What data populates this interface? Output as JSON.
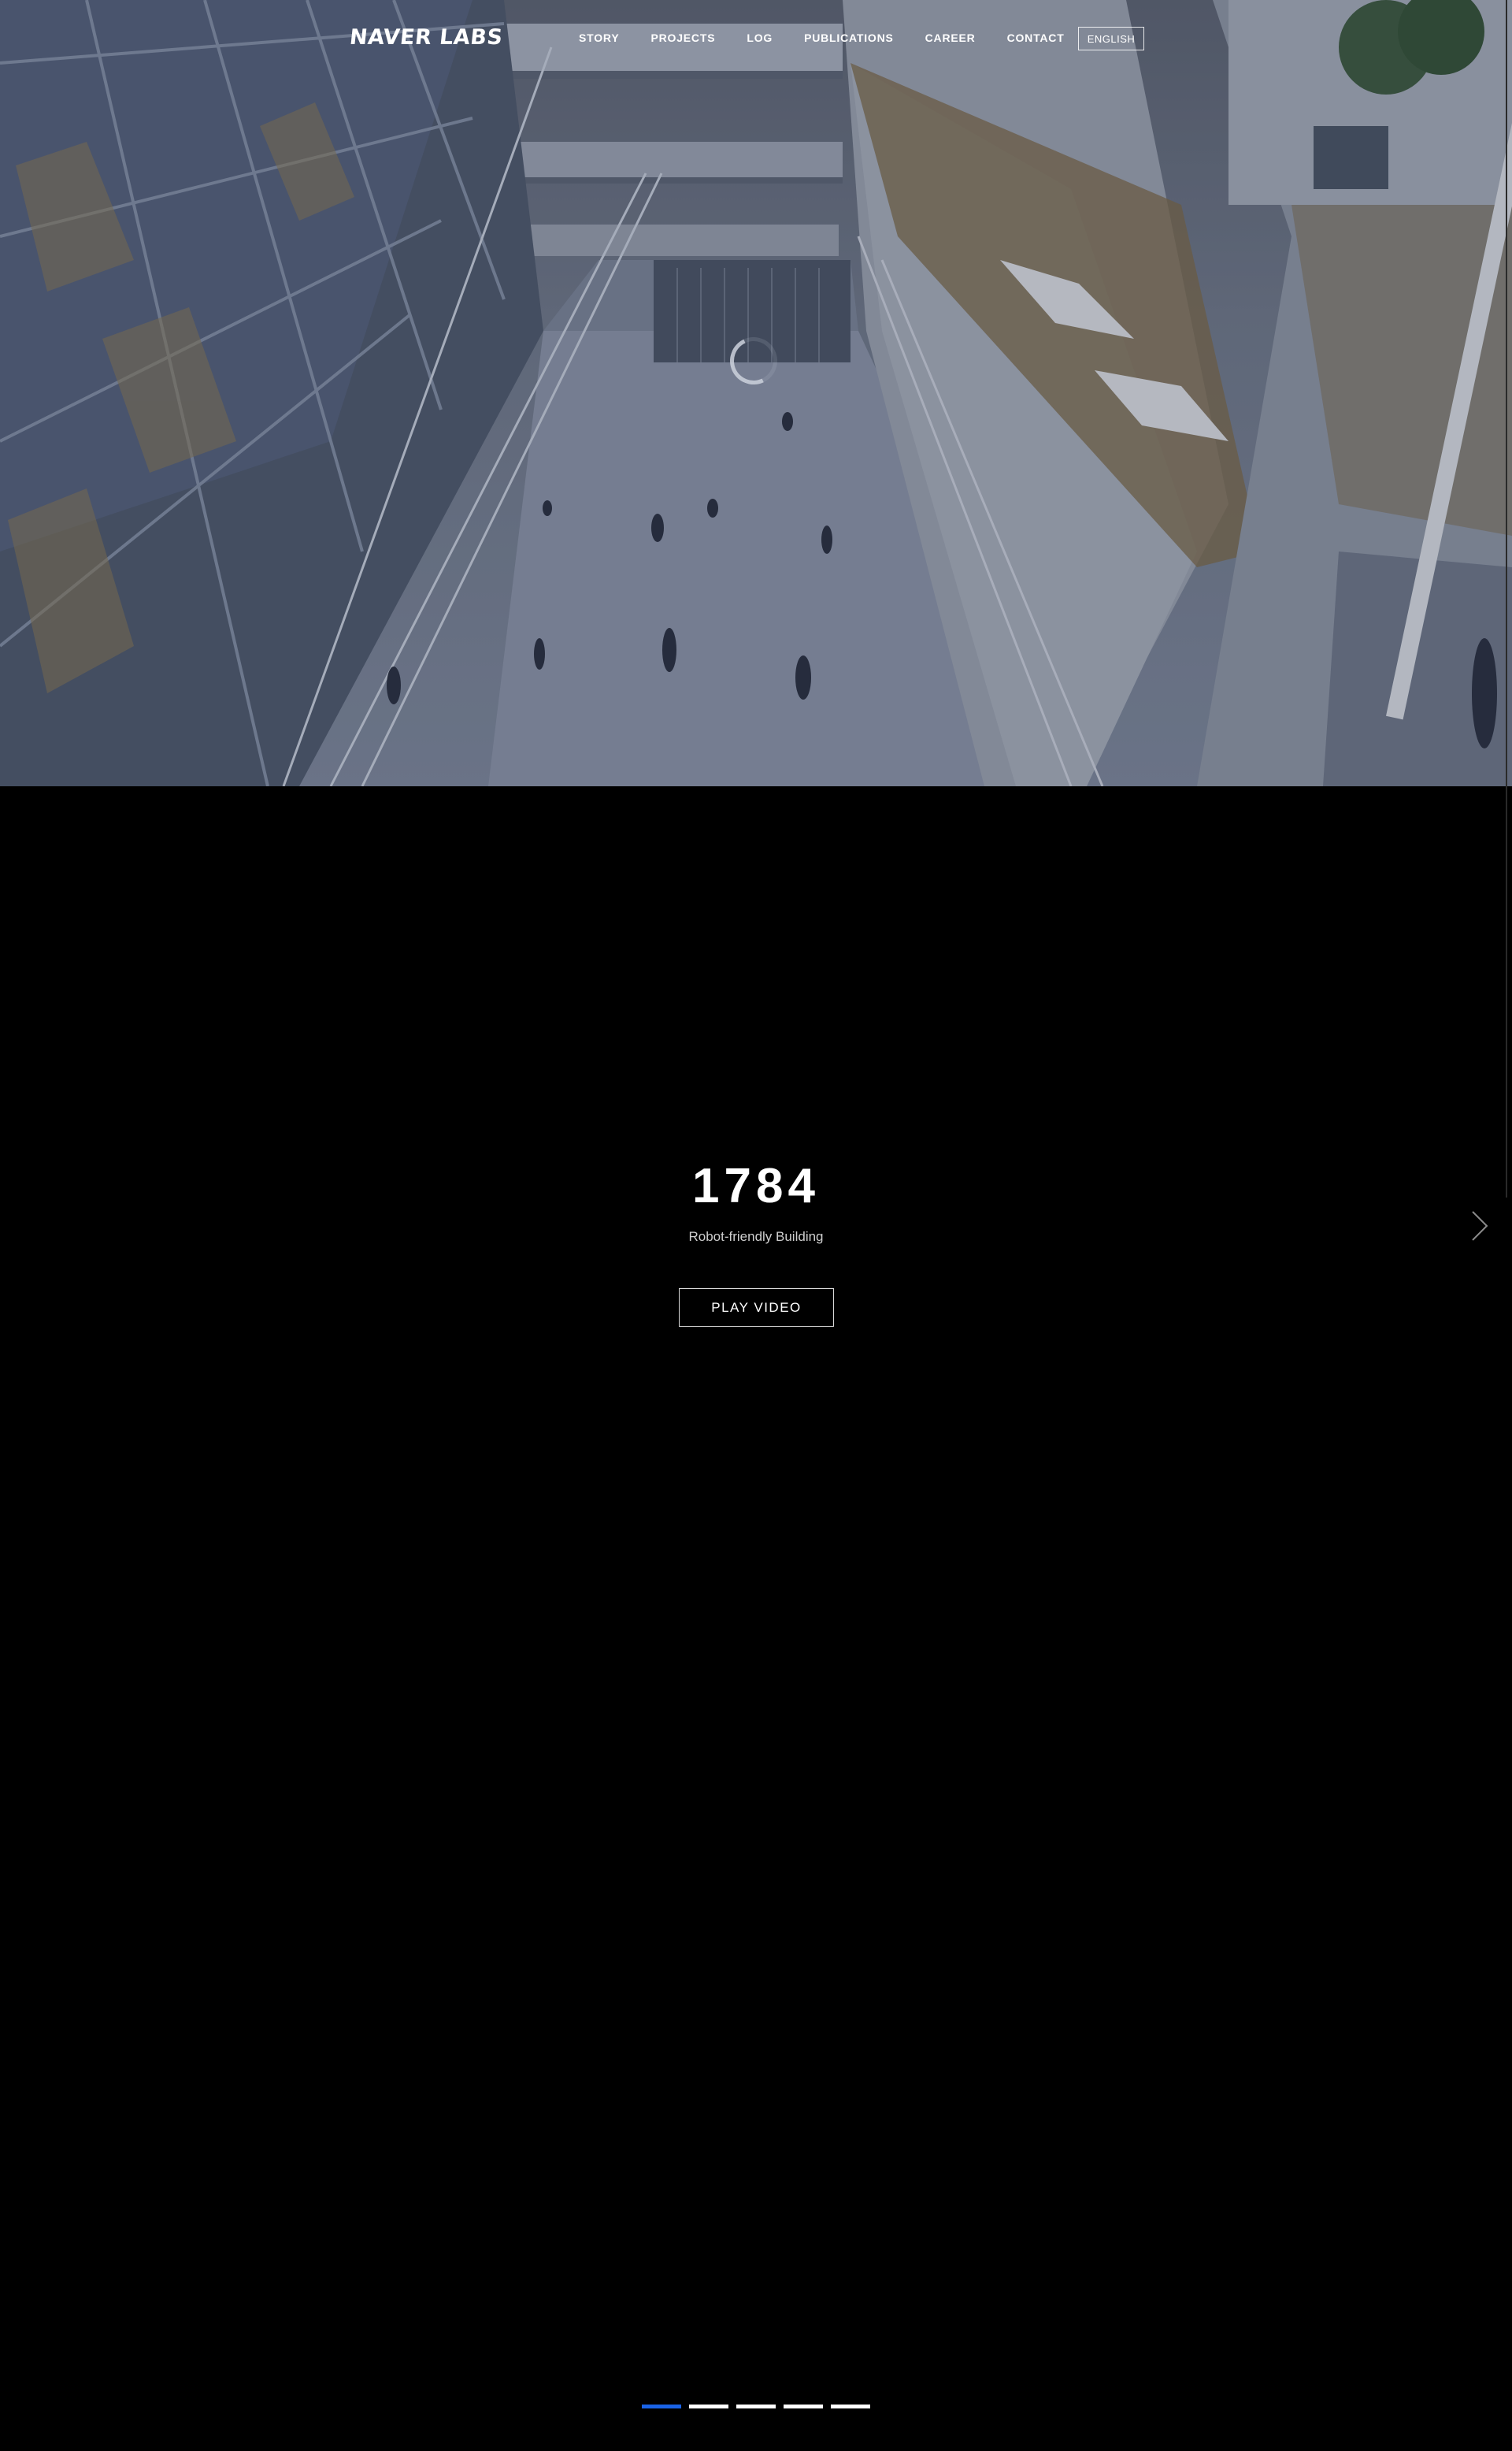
{
  "header": {
    "logo": "NAVER LABS",
    "nav": [
      {
        "label": "STORY"
      },
      {
        "label": "PROJECTS"
      },
      {
        "label": "LOG"
      },
      {
        "label": "PUBLICATIONS"
      },
      {
        "label": "CAREER"
      },
      {
        "label": "CONTACT"
      }
    ],
    "language": "ENGLISH"
  },
  "slide": {
    "title": "1784",
    "subtitle": "Robot-friendly Building",
    "play_label": "PLAY VIDEO"
  },
  "pagination": {
    "count": 5,
    "active_index": 0,
    "active_color": "#1a63e6",
    "inactive_color": "#ffffff"
  },
  "icons": {
    "next": "chevron-right-icon",
    "loading": "loading-spinner-icon"
  }
}
